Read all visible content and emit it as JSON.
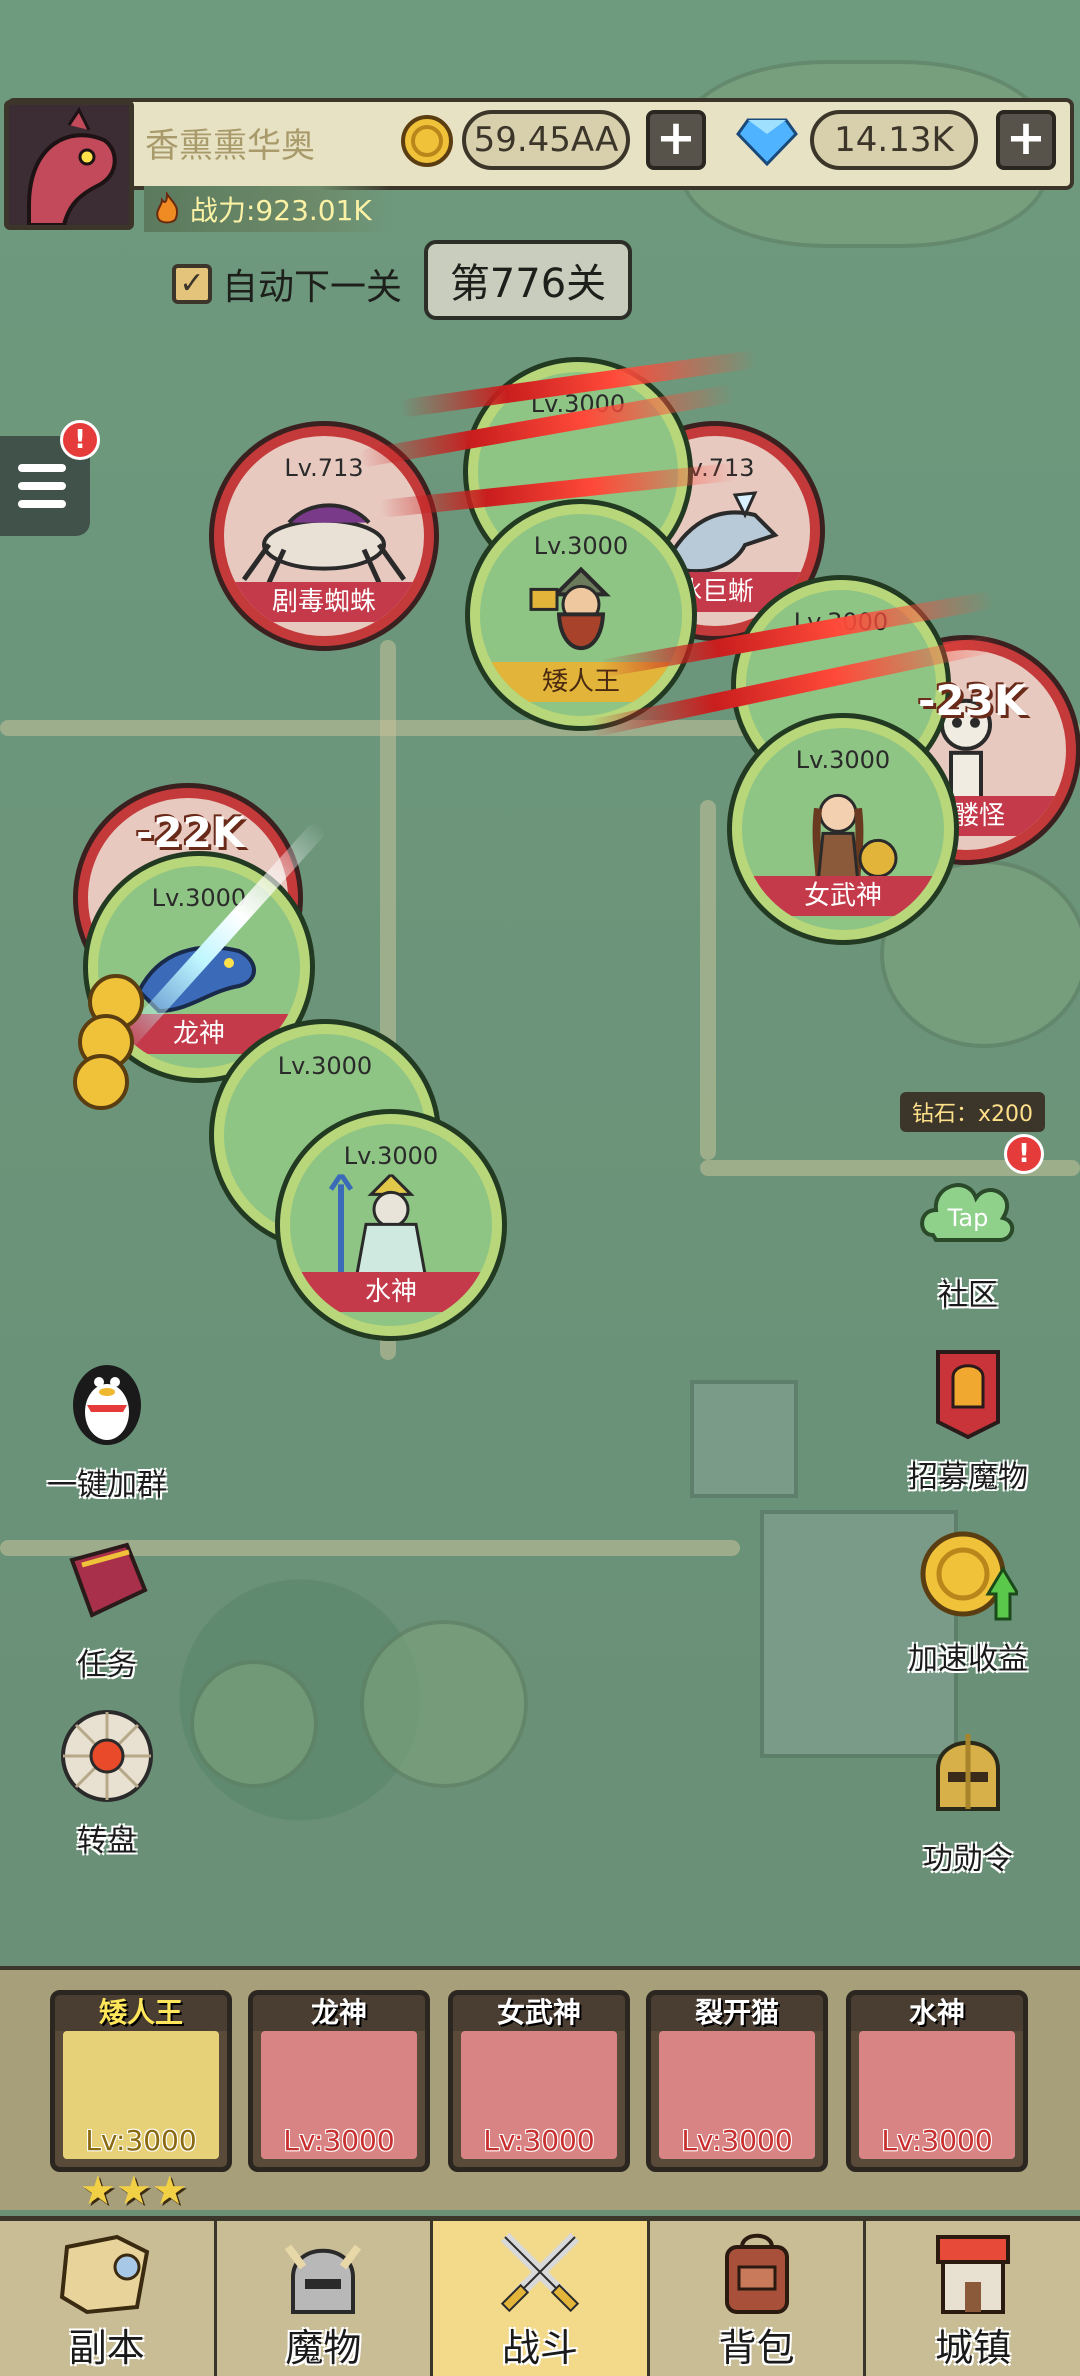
{
  "player": {
    "name": "香熏熏华奥",
    "power": "战力:923.01K",
    "gold": "59.45AA",
    "gems": "14.13K"
  },
  "stage": {
    "auto_next_label": "自动下一关",
    "auto_next_checked": true,
    "current": "第776关"
  },
  "battle": {
    "enemies": [
      {
        "level": "Lv.713",
        "name": "剧毒蜘蛛"
      },
      {
        "level": "Lv.713",
        "name": "冰巨蜥"
      },
      {
        "level": "Lv.3000",
        "name": "骷髅怪"
      }
    ],
    "allies": [
      {
        "level": "Lv.3000",
        "name": "矮人王"
      },
      {
        "level": "Lv.3000",
        "name": "女武神"
      },
      {
        "level": "Lv.3000",
        "name": "龙神"
      },
      {
        "level": "Lv.3000",
        "name": "裂开猫"
      },
      {
        "level": "Lv.3000",
        "name": "水神"
      }
    ],
    "damage_numbers": [
      "-22K",
      "-23K"
    ]
  },
  "side_right": {
    "diamond_reward": "钻石：x200",
    "community": "社区",
    "community_tap": "Tap",
    "recruit": "招募魔物",
    "speed_up": "加速收益",
    "merit_order": "功勋令"
  },
  "side_left": {
    "join_group": "一键加群",
    "tasks": "任务",
    "wheel": "转盘"
  },
  "roster": [
    {
      "name": "矮人王",
      "level": "Lv:3000",
      "selected": true,
      "stars": 3
    },
    {
      "name": "龙神",
      "level": "Lv:3000",
      "selected": false
    },
    {
      "name": "女武神",
      "level": "Lv:3000",
      "selected": false
    },
    {
      "name": "裂开猫",
      "level": "Lv:3000",
      "selected": false
    },
    {
      "name": "水神",
      "level": "Lv:3000",
      "selected": false
    }
  ],
  "stars": "★★★",
  "nav": [
    {
      "label": "副本",
      "icon": "map-scroll-icon"
    },
    {
      "label": "魔物",
      "icon": "helmet-icon"
    },
    {
      "label": "战斗",
      "icon": "crossed-swords-icon",
      "active": true
    },
    {
      "label": "背包",
      "icon": "backpack-icon"
    },
    {
      "label": "城镇",
      "icon": "town-icon"
    }
  ],
  "colors": {
    "map_green": "#6b8f76",
    "enemy_ring": "#c43a3a",
    "ally_ring": "#b8d67a",
    "active_tab": "#f3d98a"
  }
}
